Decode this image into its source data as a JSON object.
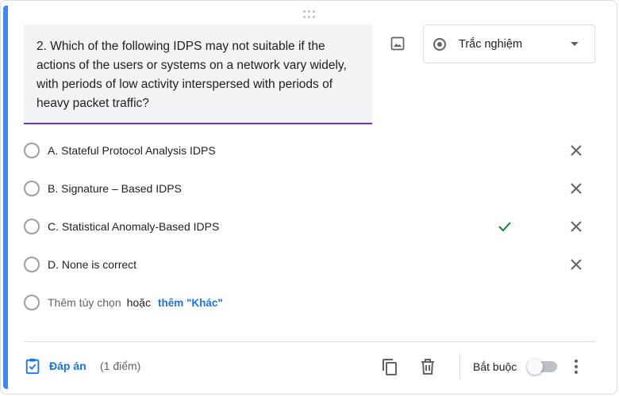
{
  "question": {
    "text": "2. Which of the following IDPS may not suitable if the actions of the users or systems on a network vary widely, with periods of low activity interspersed with periods of heavy packet traffic?"
  },
  "type_select": {
    "selected": "Trắc nghiệm",
    "icon": "radio-button-icon"
  },
  "options": [
    {
      "label": "A. Stateful Protocol Analysis IDPS",
      "correct": false
    },
    {
      "label": "B. Signature – Based IDPS",
      "correct": false
    },
    {
      "label": "C. Statistical Anomaly-Based IDPS",
      "correct": true
    },
    {
      "label": "D. None is correct",
      "correct": false
    }
  ],
  "add_option": {
    "label": "Thêm tùy chọn",
    "or": "hoặc",
    "add_other": "thêm \"Khác\""
  },
  "footer": {
    "answer_key": "Đáp án",
    "points": "(1 điểm)",
    "required": "Bắt buộc",
    "required_on": false
  },
  "colors": {
    "accent": "#4285f4",
    "underline": "#673ab7",
    "link": "#1a73e8",
    "correct": "#188038"
  }
}
